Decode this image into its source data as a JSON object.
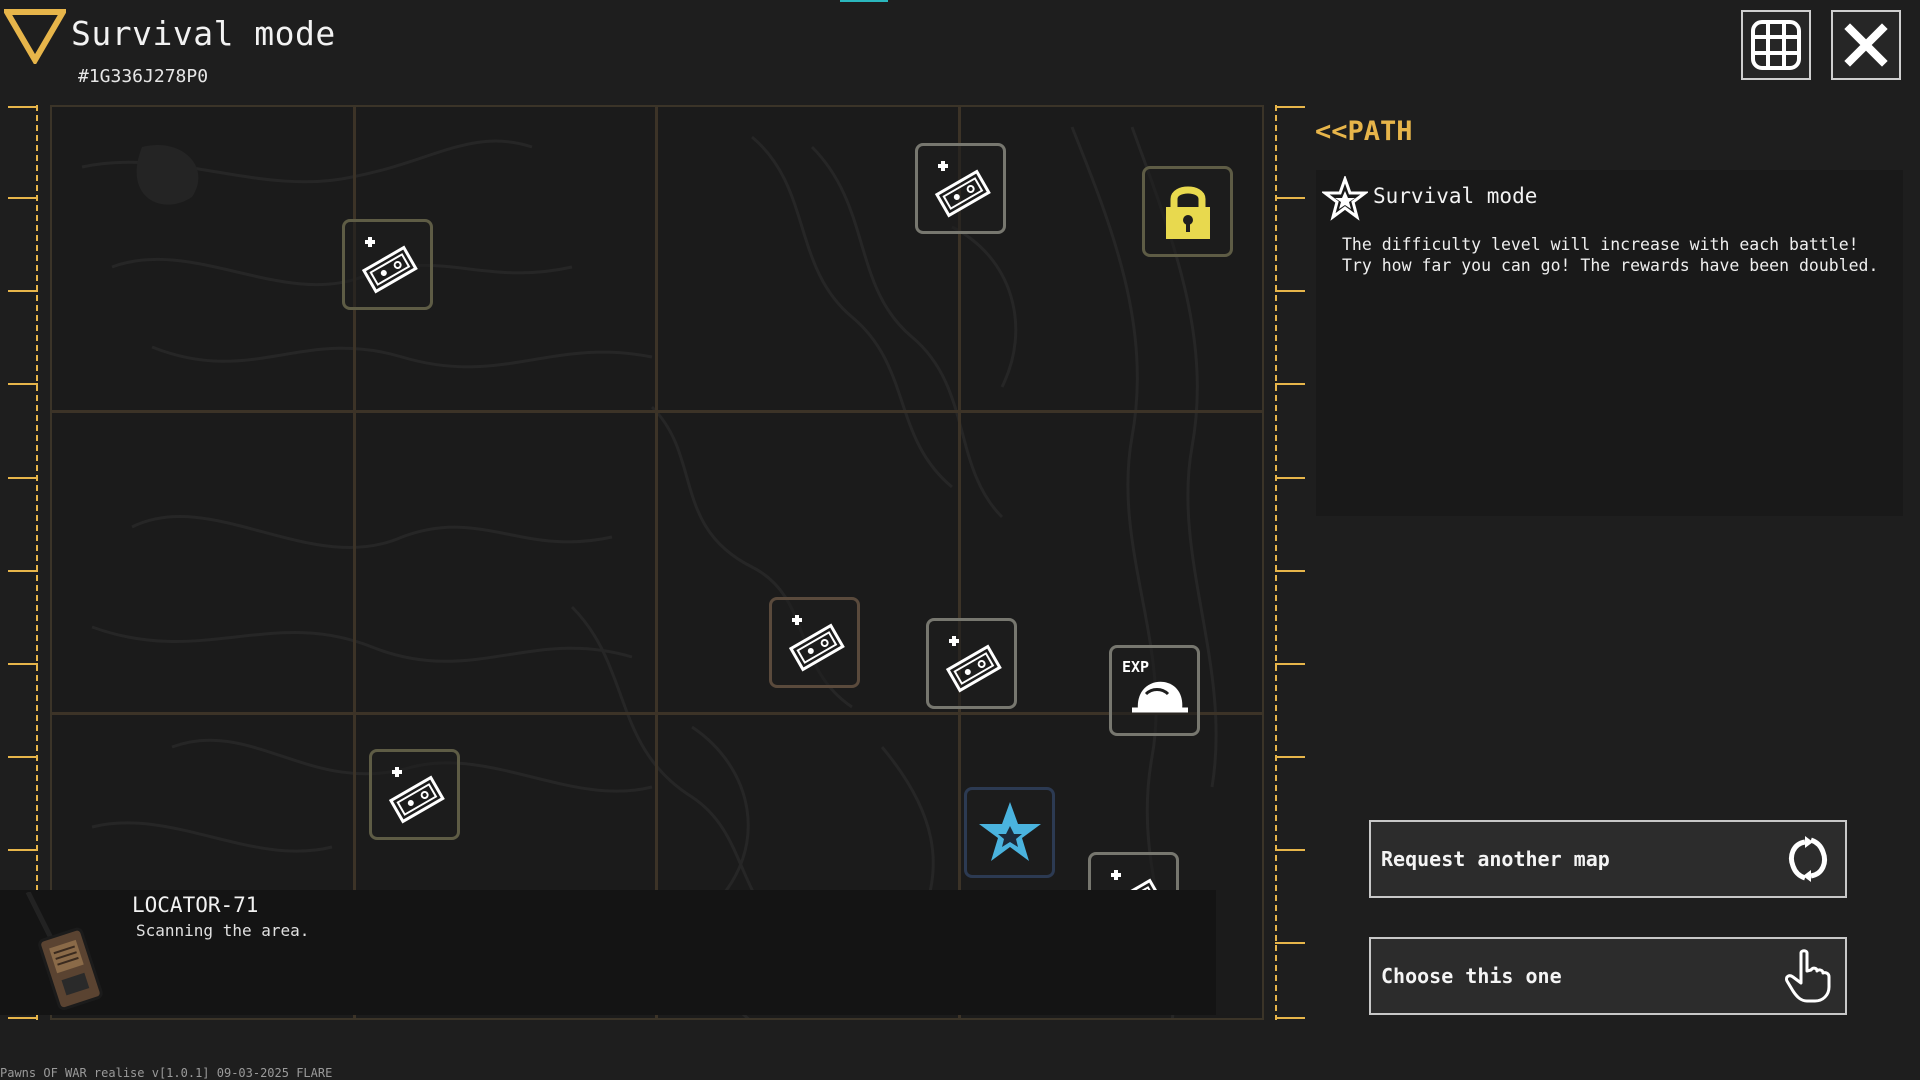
{
  "header": {
    "title": "Survival mode",
    "map_code": "#1G336J278P0"
  },
  "toolbar": {
    "grid_icon": "grid-icon",
    "close_icon": "close-icon"
  },
  "map": {
    "nodes": [
      {
        "type": "reward",
        "icon": "cash-reward-icon"
      },
      {
        "type": "reward",
        "icon": "cash-reward-icon"
      },
      {
        "type": "locked",
        "icon": "padlock-icon"
      },
      {
        "type": "reward",
        "icon": "cash-reward-icon"
      },
      {
        "type": "reward",
        "icon": "cash-reward-icon"
      },
      {
        "type": "exp",
        "icon": "exp-helmet-icon",
        "label": "EXP"
      },
      {
        "type": "reward",
        "icon": "cash-reward-icon"
      },
      {
        "type": "current",
        "icon": "star-icon"
      },
      {
        "type": "reward",
        "icon": "cash-reward-icon"
      }
    ]
  },
  "locator": {
    "name": "LOCATOR-71",
    "status": "Scanning the area."
  },
  "footer": {
    "version": "Pawns OF WAR realise v[1.0.1] 09-03-2025 FLARE"
  },
  "side": {
    "path_label": "<<PATH",
    "mode_title": "Survival mode",
    "mode_description": "The difficulty level will increase with each battle! Try how far you can go! The rewards have been doubled.",
    "request_label": "Request another map",
    "choose_label": "Choose this one"
  },
  "colors": {
    "accent_gold": "#e7b54a",
    "padlock_yellow": "#e8d94e",
    "star_blue": "#4ab3de"
  }
}
